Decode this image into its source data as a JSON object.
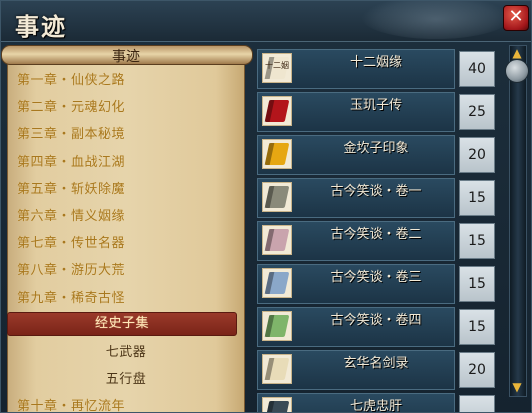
{
  "window": {
    "title": "事迹",
    "close_label": "✕"
  },
  "scroll": {
    "title": "事迹",
    "items": [
      {
        "label": "第一章・仙侠之路",
        "type": "chapter"
      },
      {
        "label": "第二章・元魂幻化",
        "type": "chapter"
      },
      {
        "label": "第三章・副本秘境",
        "type": "chapter"
      },
      {
        "label": "第四章・血战江湖",
        "type": "chapter"
      },
      {
        "label": "第五章・斩妖除魔",
        "type": "chapter"
      },
      {
        "label": "第六章・情义姻缘",
        "type": "chapter"
      },
      {
        "label": "第七章・传世名器",
        "type": "chapter"
      },
      {
        "label": "第八章・游历大荒",
        "type": "chapter"
      },
      {
        "label": "第九章・稀奇古怪",
        "type": "chapter"
      },
      {
        "label": "经史子集",
        "type": "selected"
      },
      {
        "label": "七武器",
        "type": "sub"
      },
      {
        "label": "五行盘",
        "type": "sub"
      },
      {
        "label": "第十章・再忆流年",
        "type": "chapter"
      }
    ]
  },
  "books": [
    {
      "name": "十二姻缘",
      "count": "40",
      "icon_name": "book-twelve-fates-icon",
      "color": "#efe6cf",
      "icon_text": "十二姻"
    },
    {
      "name": "玉玑子传",
      "count": "25",
      "icon_name": "book-red-icon",
      "color": "#b3151b",
      "icon_text": ""
    },
    {
      "name": "金坎子印象",
      "count": "20",
      "icon_name": "book-gold-icon",
      "color": "#e6a712",
      "icon_text": ""
    },
    {
      "name": "古今笑谈・卷一",
      "count": "15",
      "icon_name": "book-grey-icon",
      "color": "#8a8a7a",
      "icon_text": ""
    },
    {
      "name": "古今笑谈・卷二",
      "count": "15",
      "icon_name": "book-pink-icon",
      "color": "#c9a4ad",
      "icon_text": ""
    },
    {
      "name": "古今笑谈・卷三",
      "count": "15",
      "icon_name": "book-blue-icon",
      "color": "#8aa7c9",
      "icon_text": ""
    },
    {
      "name": "古今笑谈・卷四",
      "count": "15",
      "icon_name": "book-green-icon",
      "color": "#7fb56a",
      "icon_text": ""
    },
    {
      "name": "玄华名剑录",
      "count": "20",
      "icon_name": "book-cream-icon",
      "color": "#e8dcb8",
      "icon_text": ""
    },
    {
      "name": "七虎忠肝",
      "count": "",
      "icon_name": "book-dark-icon",
      "color": "#3a4a55",
      "icon_text": ""
    }
  ],
  "scrollbar": {
    "up_label": "▲",
    "down_label": "▼"
  }
}
